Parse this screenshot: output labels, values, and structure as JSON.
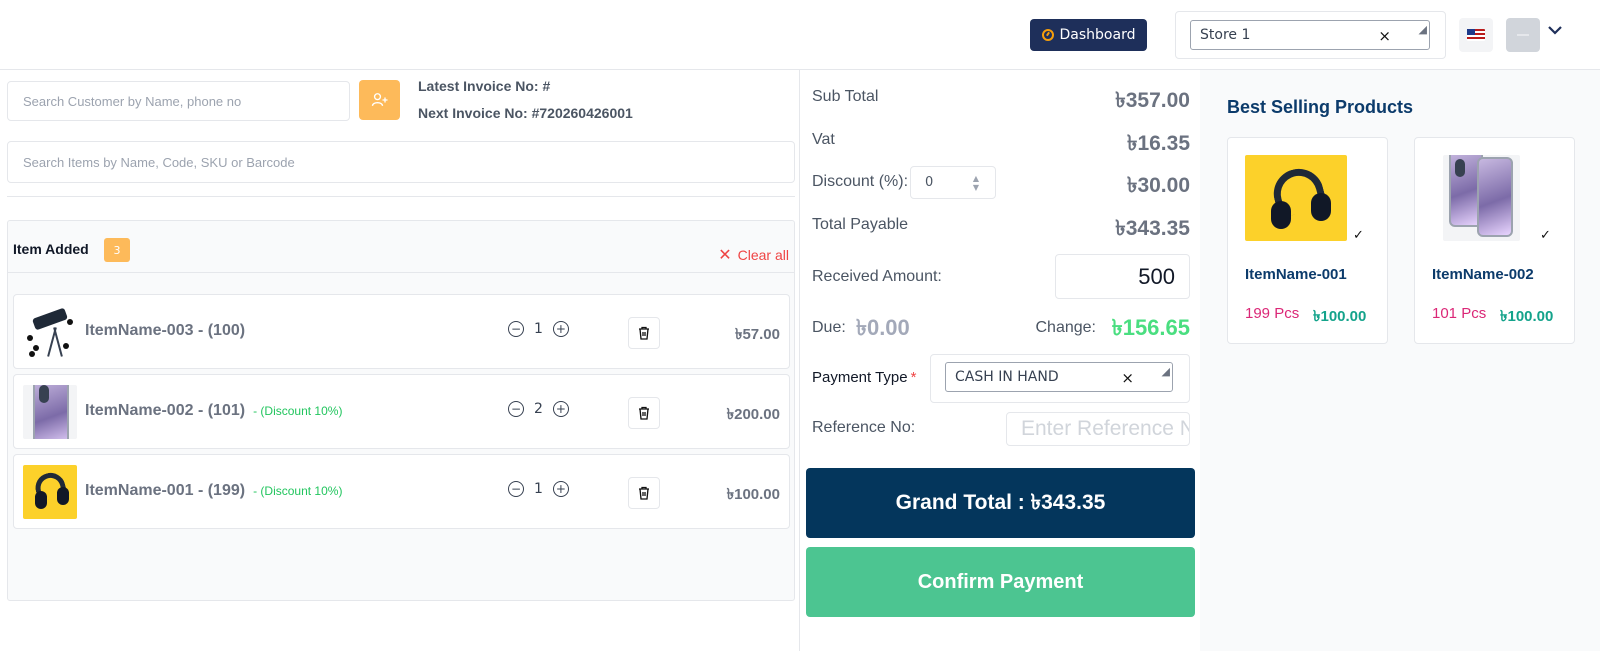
{
  "header": {
    "dashboard_label": "Dashboard",
    "store_value": "Store 1",
    "clear_glyph": "×",
    "icons": [
      "dashboard-gauge-icon",
      "us-flag-icon",
      "avatar",
      "chevron-down-icon"
    ]
  },
  "left": {
    "customer_search_placeholder": "Search Customer by Name, phone no",
    "latest_invoice": "Latest Invoice No: #",
    "next_invoice": "Next Invoice No: #720260426001",
    "item_search_placeholder": "Search Items by Name, Code, SKU or Barcode",
    "items_title": "Item Added",
    "items_count": "3",
    "clear_all": "Clear all",
    "items": [
      {
        "name": "ItemName-003 - (100)",
        "discount": "",
        "qty": "1",
        "price": "৳57.00",
        "image": "telescope"
      },
      {
        "name": "ItemName-002 - (101)",
        "discount": "- (Discount 10%)",
        "qty": "2",
        "price": "৳200.00",
        "image": "phone"
      },
      {
        "name": "ItemName-001 - (199)",
        "discount": "- (Discount 10%)",
        "qty": "1",
        "price": "৳100.00",
        "image": "headphones"
      }
    ]
  },
  "summary": {
    "subtotal_label": "Sub Total",
    "subtotal_value": "৳357.00",
    "vat_label": "Vat",
    "vat_value": "৳16.35",
    "discount_label": "Discount (%):",
    "discount_input": "0",
    "discount_value": "৳30.00",
    "total_label": "Total Payable",
    "total_value": "৳343.35",
    "received_label": "Received Amount:",
    "received_value": "500",
    "due_label": "Due:",
    "due_value": "৳0.00",
    "change_label": "Change:",
    "change_value": "৳156.65",
    "payment_type_label": "Payment Type",
    "required_mark": "*",
    "payment_type_value": "CASH IN HAND",
    "reference_label": "Reference No:",
    "reference_placeholder": "Enter Reference No",
    "grand_total": "Grand Total : ৳343.35",
    "confirm_label": "Confirm Payment"
  },
  "best_selling": {
    "title": "Best Selling Products",
    "products": [
      {
        "name": "ItemName-001",
        "stock": "199 Pcs",
        "price": "৳100.00"
      },
      {
        "name": "ItemName-002",
        "stock": "101 Pcs",
        "price": "৳100.00"
      }
    ]
  },
  "colors": {
    "dashboard_bg": "#1e2f5a",
    "accent_orange": "#fdba5a",
    "grand_total_bg": "#04365c",
    "confirm_bg": "#4cc591",
    "change_green": "#4ade80",
    "clear_red": "#ef4444"
  }
}
